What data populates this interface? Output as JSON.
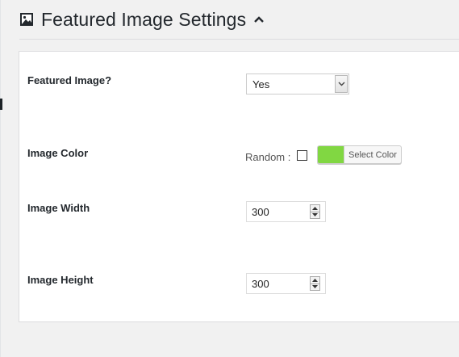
{
  "metabox": {
    "title": "Featured Image Settings",
    "icon": "image-icon",
    "toggle_icon": "chevron-up-icon"
  },
  "fields": {
    "featured_image": {
      "label": "Featured Image?",
      "value": "Yes"
    },
    "image_color": {
      "label": "Image Color",
      "random_label": "Random :",
      "random_checked": false,
      "button_label": "Select Color",
      "swatch_color": "#81d742"
    },
    "image_width": {
      "label": "Image Width",
      "value": "300"
    },
    "image_height": {
      "label": "Image Height",
      "value": "300"
    }
  }
}
